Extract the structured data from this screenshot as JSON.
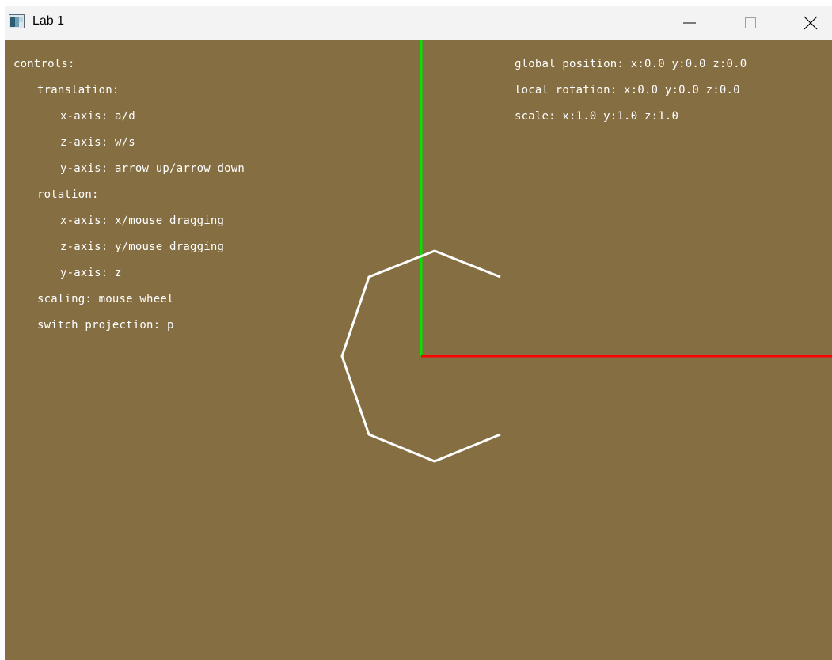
{
  "window": {
    "title": "Lab 1"
  },
  "colors": {
    "background": "#866e43",
    "x_axis": "#ff0000",
    "y_axis": "#00e600",
    "shape": "#ffffff",
    "text": "#ffffff"
  },
  "controls": {
    "header": "controls:",
    "translation": "translation:",
    "translation_x": "x-axis: a/d",
    "translation_z": "z-axis: w/s",
    "translation_y": "y-axis: arrow up/arrow down",
    "rotation": "rotation:",
    "rotation_x": "x-axis: x/mouse dragging",
    "rotation_z": "z-axis: y/mouse dragging",
    "rotation_y": "y-axis: z",
    "scaling": "scaling: mouse wheel",
    "projection": "switch projection: p"
  },
  "status": {
    "position": "global position: x:0.0 y:0.0 z:0.0",
    "rotation": "local rotation: x:0.0 y:0.0 z:0.0",
    "scale": "scale: x:1.0 y:1.0 z:1.0"
  },
  "icons": {
    "app": "app-icon",
    "minimize": "minimize-icon",
    "maximize": "maximize-icon",
    "close": "close-icon"
  }
}
